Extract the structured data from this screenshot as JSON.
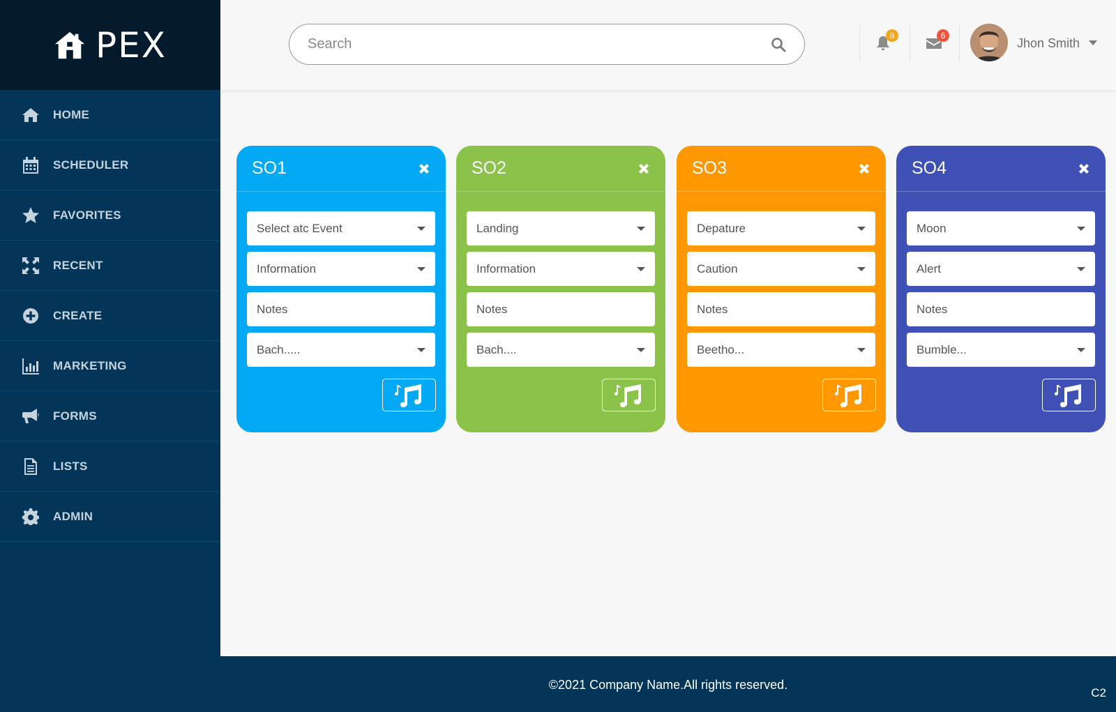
{
  "brand": {
    "name": "PEX"
  },
  "sidebar": {
    "items": [
      {
        "label": "HOME",
        "icon": "home-icon"
      },
      {
        "label": "SCHEDULER",
        "icon": "calendar-icon"
      },
      {
        "label": "FAVORITES",
        "icon": "star-icon"
      },
      {
        "label": "RECENT",
        "icon": "expand-icon"
      },
      {
        "label": "CREATE",
        "icon": "plus-circle-icon"
      },
      {
        "label": "MARKETING",
        "icon": "bar-chart-icon"
      },
      {
        "label": "FORMS",
        "icon": "megaphone-icon"
      },
      {
        "label": "LISTS",
        "icon": "document-icon"
      },
      {
        "label": "ADMIN",
        "icon": "gear-icon"
      }
    ]
  },
  "header": {
    "search_placeholder": "Search",
    "notifications_count": "8",
    "messages_count": "6",
    "user_name": "Jhon Smith"
  },
  "cards": [
    {
      "title": "SO1",
      "color": "#03a9f4",
      "fields": [
        "Select atc Event",
        "Information",
        "Notes",
        "Bach....."
      ]
    },
    {
      "title": "SO2",
      "color": "#8bc34a",
      "fields": [
        "Landing",
        "Information",
        "Notes",
        "Bach...."
      ]
    },
    {
      "title": "SO3",
      "color": "#ff9800",
      "fields": [
        "Depature",
        "Caution",
        "Notes",
        "Beetho..."
      ]
    },
    {
      "title": "SO4",
      "color": "#3f51b5",
      "fields": [
        "Moon",
        "Alert",
        "Notes",
        "Bumble..."
      ]
    }
  ],
  "footer": {
    "copyright": "©2021 Company Name.All rights reserved.",
    "code": "C2"
  }
}
